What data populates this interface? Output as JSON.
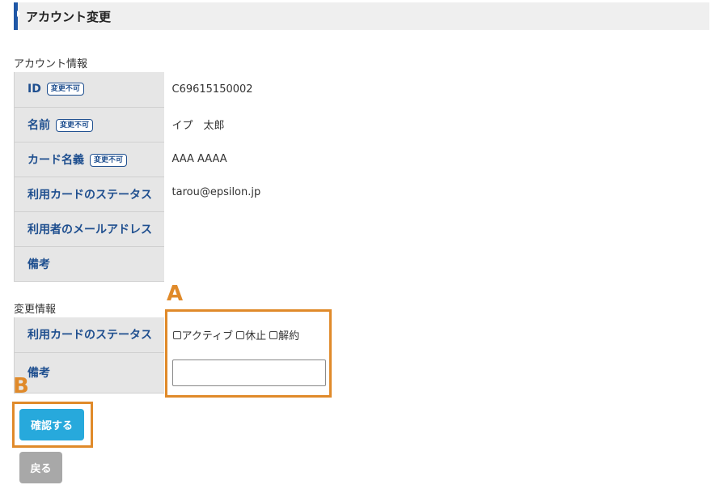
{
  "header": {
    "title": "アカウント変更"
  },
  "account_info": {
    "section_label": "アカウント情報",
    "badge_label": "変更不可",
    "rows": [
      {
        "label": "ID",
        "value": "C69615150002",
        "locked": true
      },
      {
        "label": "名前",
        "value": "イプ　太郎",
        "locked": true
      },
      {
        "label": "カード名義",
        "value": "AAA AAAA",
        "locked": true
      },
      {
        "label": "利用カードのステータス",
        "value": "tarou@epsilon.jp",
        "locked": false
      },
      {
        "label": "利用者のメールアドレス",
        "value": "",
        "locked": false
      },
      {
        "label": "備考",
        "value": "",
        "locked": false
      }
    ]
  },
  "change_info": {
    "section_label": "変更情報",
    "status_label": "利用カードのステータス",
    "status_options": [
      {
        "label": "アクティブ",
        "checked": false
      },
      {
        "label": "休止",
        "checked": false
      },
      {
        "label": "解約",
        "checked": false
      }
    ],
    "memo_label": "備考",
    "memo_value": "",
    "memo_placeholder": ""
  },
  "annotations": {
    "a": "A",
    "b": "B"
  },
  "buttons": {
    "confirm": "確認する",
    "back": "戻る"
  },
  "colors": {
    "accent": "#1f57a6",
    "label_text": "#1f4f8f",
    "confirm_button": "#27a9dc",
    "back_button": "#a8a8a8",
    "annotation": "#e08a2a"
  }
}
